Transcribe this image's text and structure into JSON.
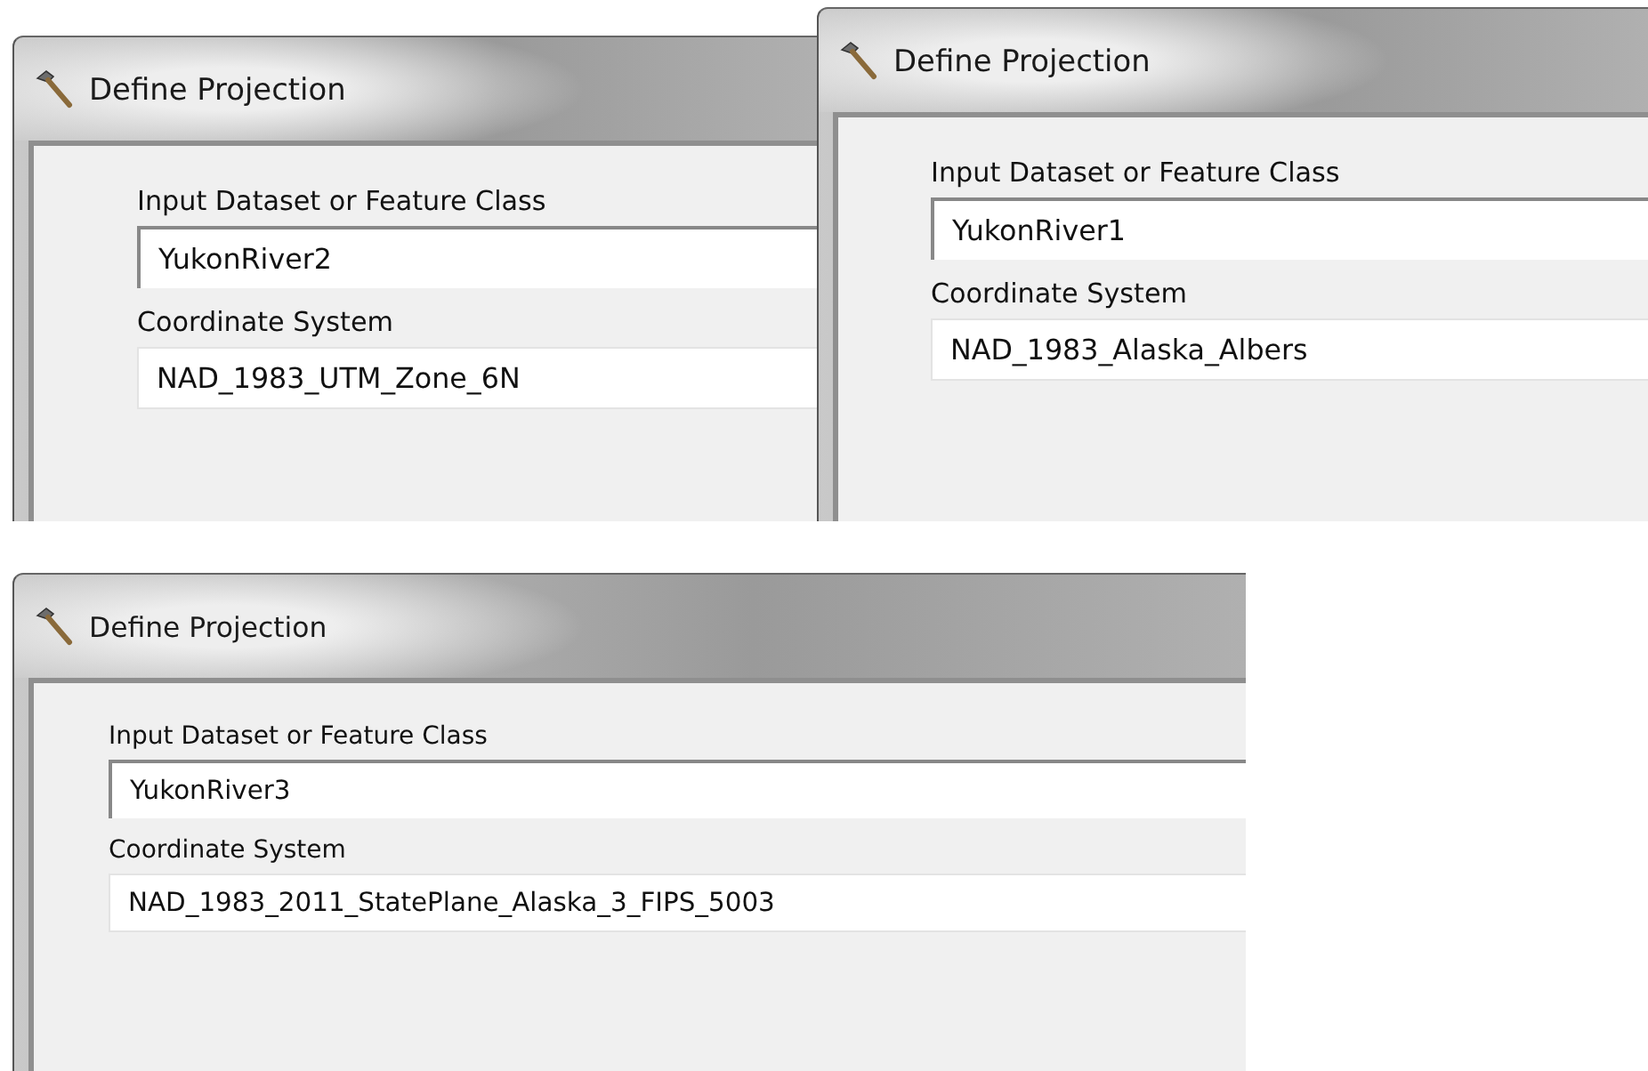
{
  "windows": [
    {
      "title": "Define Projection",
      "fields": [
        {
          "label": "Input Dataset or Feature Class",
          "value": "YukonRiver2",
          "kind": "input"
        },
        {
          "label": "Coordinate System",
          "value": "NAD_1983_UTM_Zone_6N",
          "kind": "readonly"
        }
      ]
    },
    {
      "title": "Define Projection",
      "fields": [
        {
          "label": "Input Dataset or Feature Class",
          "value": "YukonRiver1",
          "kind": "input"
        },
        {
          "label": "Coordinate System",
          "value": "NAD_1983_Alaska_Albers",
          "kind": "readonly"
        }
      ]
    },
    {
      "title": "Define Projection",
      "fields": [
        {
          "label": "Input Dataset or Feature Class",
          "value": "YukonRiver3",
          "kind": "input"
        },
        {
          "label": "Coordinate System",
          "value": "NAD_1983_2011_StatePlane_Alaska_3_FIPS_5003",
          "kind": "readonly"
        }
      ]
    }
  ]
}
